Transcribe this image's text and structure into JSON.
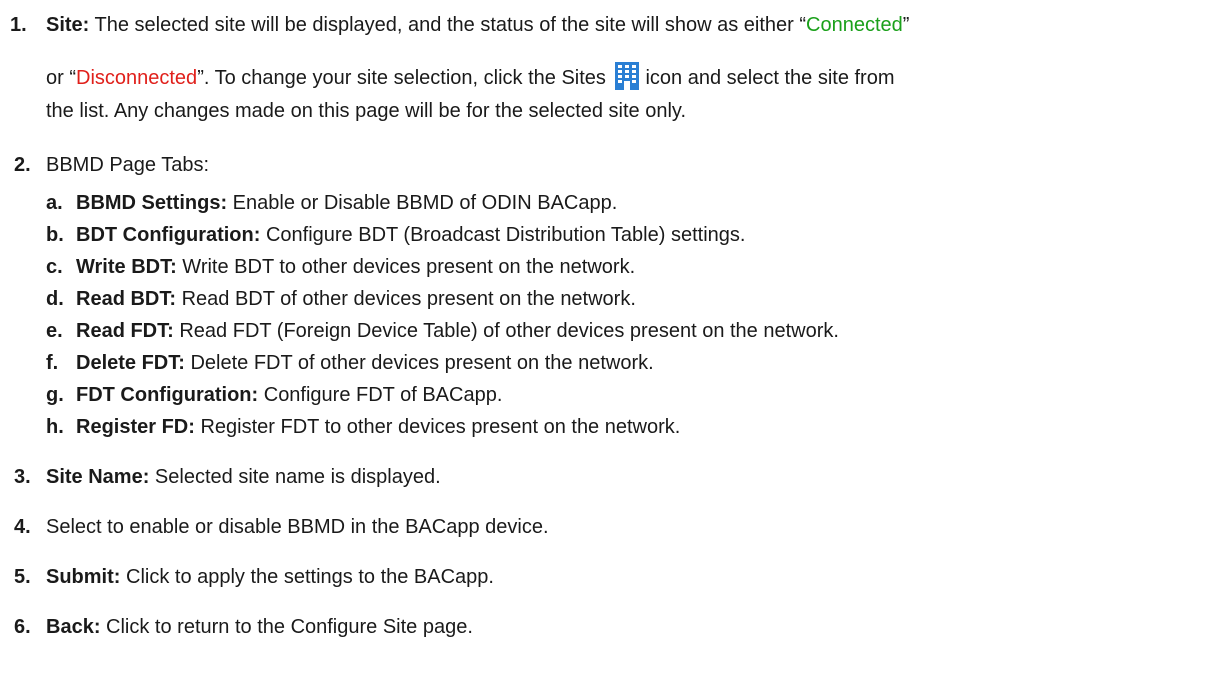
{
  "item1": {
    "number": "1.",
    "label": "Site:",
    "text_a": " The selected site will be displayed, and the status of the site will show as either “",
    "connected": "Connected",
    "text_b": "”",
    "text_c": "or “",
    "disconnected": "Disconnected",
    "text_d": "”. To change your site selection, click the Sites",
    "icon": "building-icon",
    "text_e": "icon and select the site from",
    "text_f": "the list. Any changes made on this page will be for the selected site only."
  },
  "item2": {
    "number": "2.",
    "label": "BBMD Page Tabs:",
    "subitems": [
      {
        "letter": "a.",
        "label": "BBMD Settings:",
        "text": " Enable or Disable BBMD of ODIN BACapp."
      },
      {
        "letter": "b.",
        "label": "BDT Configuration:",
        "text": " Configure BDT (Broadcast Distribution Table) settings."
      },
      {
        "letter": "c.",
        "label": "Write BDT:",
        "text": " Write BDT to other devices present on the network."
      },
      {
        "letter": "d.",
        "label": "Read BDT:",
        "text": " Read BDT of other devices present on the network."
      },
      {
        "letter": "e.",
        "label": "Read FDT:",
        "text": " Read FDT (Foreign Device Table) of other devices present on the network."
      },
      {
        "letter": "f.",
        "label": "Delete FDT:",
        "text": " Delete FDT of other devices present on the network."
      },
      {
        "letter": "g.",
        "label": "FDT Configuration:",
        "text": " Configure FDT of BACapp."
      },
      {
        "letter": "h.",
        "label": "Register FD:",
        "text": " Register FDT to other devices present on the network."
      }
    ]
  },
  "item3": {
    "number": "3.",
    "label": "Site Name:",
    "text": " Selected site name is displayed."
  },
  "item4": {
    "number": "4.",
    "text": "Select to enable or disable BBMD in the BACapp device."
  },
  "item5": {
    "number": "5.",
    "label": "Submit:",
    "text": " Click to apply the settings to the BACapp."
  },
  "item6": {
    "number": "6.",
    "label": "Back:",
    "text": " Click to return to the Configure Site page."
  },
  "colors": {
    "connected": "#1aa01a",
    "disconnected": "#e0201b",
    "icon": "#2a7fd4"
  }
}
